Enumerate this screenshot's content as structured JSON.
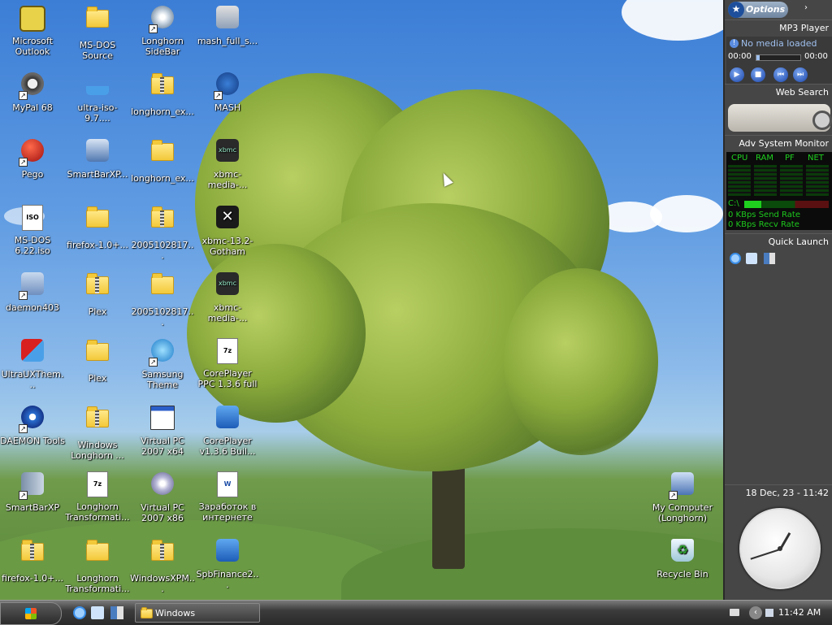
{
  "desktop": {
    "icons": [
      {
        "label": "Microsoft Outlook"
      },
      {
        "label": "MS-DOS Source"
      },
      {
        "label": "Longhorn SideBar"
      },
      {
        "label": "mash_full_s..."
      },
      {
        "label": "MyPal 68"
      },
      {
        "label": "ultra-iso-9.7...."
      },
      {
        "label": "longhorn_ex..."
      },
      {
        "label": "MASH"
      },
      {
        "label": "Pego"
      },
      {
        "label": "SmartBarXP..."
      },
      {
        "label": "longhorn_ex..."
      },
      {
        "label": "xbmc-media-..."
      },
      {
        "label": "MS-DOS 6.22.iso",
        "badge": "ISO"
      },
      {
        "label": "firefox-1.0+..."
      },
      {
        "label": "2005102817..."
      },
      {
        "label": "xbmc-13.2-Gotham"
      },
      {
        "label": "daemon403"
      },
      {
        "label": "Plex"
      },
      {
        "label": "2005102817..."
      },
      {
        "label": "xbmc-media-..."
      },
      {
        "label": "UltraUXThem..."
      },
      {
        "label": "Plex"
      },
      {
        "label": "Samsung Theme"
      },
      {
        "label": "CorePlayer PPC 1.3.6 full",
        "badge": "7z"
      },
      {
        "label": "DAEMON Tools"
      },
      {
        "label": "Windows Longhorn ..."
      },
      {
        "label": "Virtual PC 2007 x64"
      },
      {
        "label": "CorePlayer v1.3.6 Buil..."
      },
      {
        "label": "SmartBarXP"
      },
      {
        "label": "Longhorn Transformati...",
        "badge": "7z"
      },
      {
        "label": "Virtual PC 2007 x86"
      },
      {
        "label": "Заработок в интернете",
        "badge": "W"
      },
      {
        "label": "firefox-1.0+..."
      },
      {
        "label": "Longhorn Transformati..."
      },
      {
        "label": "WindowsXPM..."
      },
      {
        "label": "SpbFinance2..."
      },
      {
        "label": "My Computer (Longhorn)"
      },
      {
        "label": "Recycle Bin"
      }
    ]
  },
  "sidebar": {
    "options_label": "Options",
    "mp3": {
      "title": "MP3 Player",
      "status": "No media loaded",
      "time_left": "00:00",
      "time_right": "00:00",
      "progress": 0
    },
    "web_search": {
      "title": "Web Search"
    },
    "monitor": {
      "title": "Adv System Monitor",
      "cols": [
        "CPU",
        "RAM",
        "PF",
        "NET"
      ],
      "drive": "C:\\",
      "send": "0 KBps Send Rate",
      "recv": "0 KBps Recv Rate"
    },
    "quick_launch": {
      "title": "Quick Launch"
    },
    "clock": {
      "date": "18 Dec, 23 - 11:42"
    }
  },
  "taskbar": {
    "task_label": "Windows",
    "time": "11:42 AM"
  },
  "colors": {
    "sidebar_bg": "#464646",
    "taskbar_bg": "#2a2a2a",
    "monitor_green": "#1fd01f"
  }
}
